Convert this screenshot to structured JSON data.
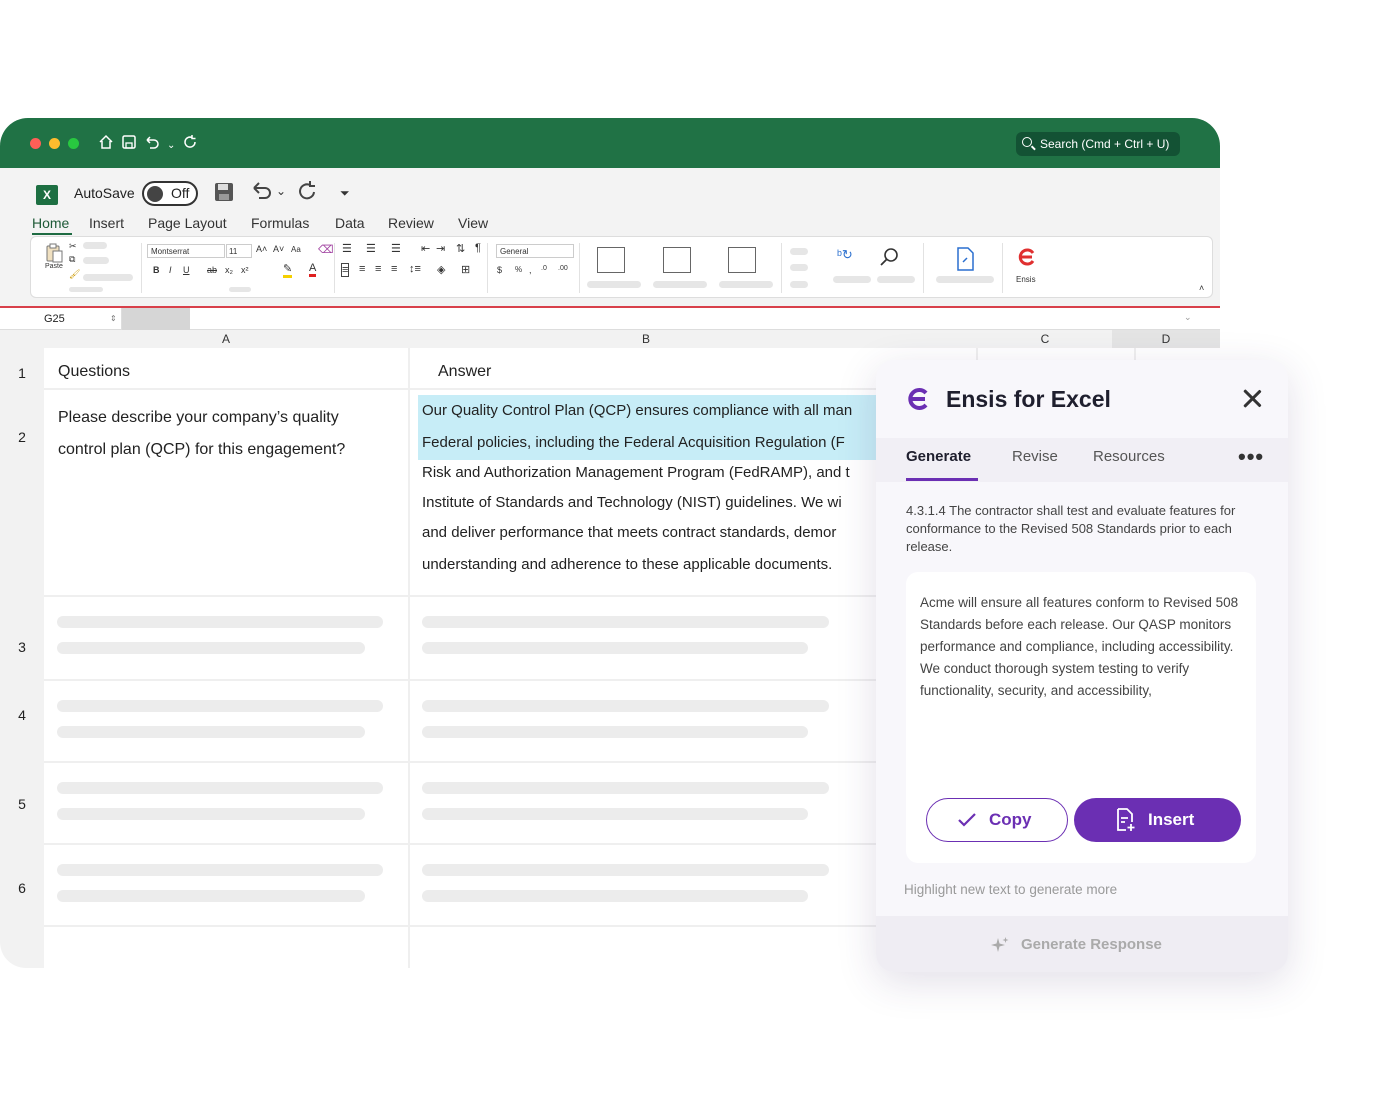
{
  "titlebar": {
    "search_placeholder": "Search (Cmd + Ctrl + U)",
    "traffic_lights": [
      "#ff5f57",
      "#febc2e",
      "#28c840"
    ],
    "accent": "#207245"
  },
  "quick_access": {
    "autosave_label": "AutoSave",
    "toggle_state": "Off"
  },
  "menu": [
    "Home",
    "Insert",
    "Page Layout",
    "Formulas",
    "Data",
    "Review",
    "View"
  ],
  "ribbon": {
    "paste_label": "Paste",
    "font_name": "Montserrat",
    "font_size": "11",
    "number_format": "General",
    "ensis_label": "Ensis"
  },
  "formula_bar": {
    "name_box": "G25"
  },
  "columns": [
    "A",
    "B",
    "C",
    "D"
  ],
  "rows": [
    "1",
    "2",
    "3",
    "4",
    "5",
    "6"
  ],
  "cells": {
    "a1": "Questions",
    "b1": "Answer",
    "a2_line1": "Please describe your company’s quality",
    "a2_line2": "control plan (QCP) for this engagement?",
    "b2_lines": [
      "Our Quality Control Plan (QCP) ensures compliance with all man",
      "Federal policies, including the Federal Acquisition Regulation (F",
      "Risk and Authorization Management Program (FedRAMP), and t",
      "Institute of Standards and Technology (NIST) guidelines. We wi",
      "and deliver performance that meets contract standards, demor",
      "understanding and adherence to these applicable documents."
    ]
  },
  "panel": {
    "title": "Ensis for Excel",
    "brand_color": "#6b2fb3",
    "tabs": [
      "Generate",
      "Revise",
      "Resources"
    ],
    "active_tab": "Generate",
    "requirement": "4.3.1.4 The contractor shall test and evaluate features for conformance to the Revised 508 Standards prior to each release.",
    "response": "Acme will ensure all features conform to Revised 508 Standards before each release. Our QASP monitors performance and compliance, including accessibility. We conduct thorough system testing to verify functionality, security, and accessibility,",
    "copy_label": "Copy",
    "insert_label": "Insert",
    "hint": "Highlight new text to generate more",
    "generate_label": "Generate Response"
  }
}
